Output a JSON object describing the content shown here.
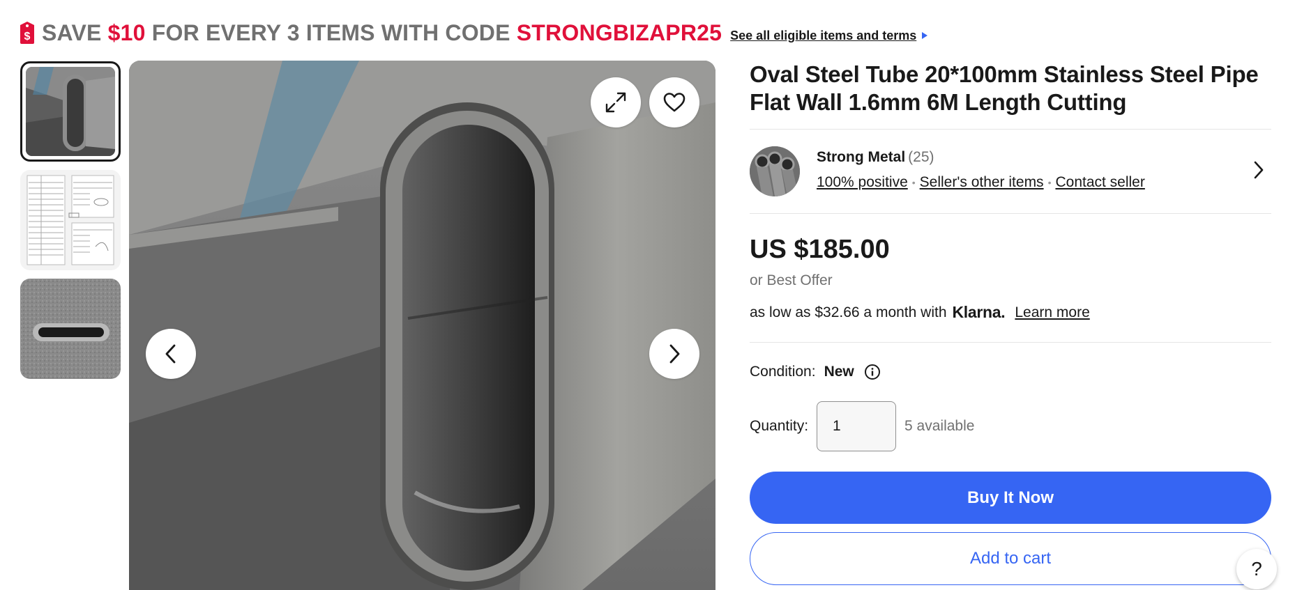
{
  "promo": {
    "text_prefix": "SAVE ",
    "amount": "$10",
    "text_middle": " FOR EVERY 3 ITEMS WITH CODE ",
    "code": "STRONGBIZAPR25",
    "link": "See all eligible items and terms",
    "icon": "sale-tag-icon"
  },
  "gallery": {
    "thumbnails": [
      {
        "name": "thumbnail-oval-tube",
        "selected": true
      },
      {
        "name": "thumbnail-size-table",
        "selected": false
      },
      {
        "name": "thumbnail-tube-end",
        "selected": false
      }
    ],
    "buttons": {
      "expand_icon": "expand-icon",
      "favorite_icon": "heart-icon",
      "prev_icon": "chevron-left-icon",
      "next_icon": "chevron-right-icon"
    }
  },
  "listing": {
    "title": "Oval Steel Tube 20*100mm Stainless Steel Pipe Flat Wall 1.6mm 6M Length Cutting"
  },
  "seller": {
    "name": "Strong Metal",
    "count": "(25)",
    "feedback": "100% positive",
    "other_items": "Seller's other items",
    "contact": "Contact seller"
  },
  "pricing": {
    "price": "US $185.00",
    "best_offer": "or Best Offer",
    "klarna_text": "as low as $32.66 a month with",
    "klarna_brand": "Klarna.",
    "learn_more": "Learn more"
  },
  "condition": {
    "label": "Condition:",
    "value": "New"
  },
  "quantity": {
    "label": "Quantity:",
    "value": "1",
    "available": "5 available"
  },
  "actions": {
    "buy_now": "Buy It Now",
    "add_to_cart": "Add to cart",
    "help": "?"
  },
  "colors": {
    "accent": "#3665f3",
    "promo_red": "#e0103a",
    "promo_gray": "#707070"
  }
}
